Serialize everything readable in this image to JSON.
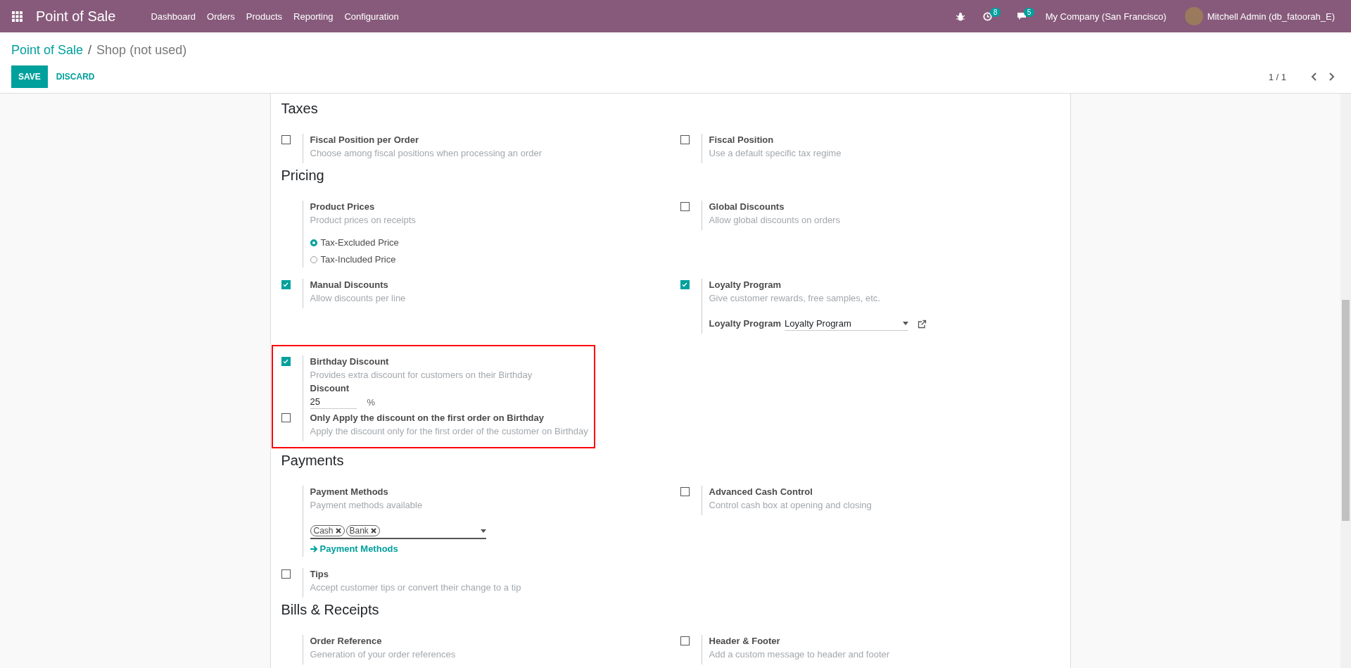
{
  "navbar": {
    "app_name": "Point of Sale",
    "menu": [
      "Dashboard",
      "Orders",
      "Products",
      "Reporting",
      "Configuration"
    ],
    "activity_count": "8",
    "message_count": "5",
    "company": "My Company (San Francisco)",
    "user": "Mitchell Admin (db_fatoorah_E)"
  },
  "breadcrumb_separator": "/",
  "breadcrumb": [
    {
      "label": "Point of Sale",
      "current": false
    },
    {
      "label": "Shop (not used)",
      "current": true
    }
  ],
  "buttons": [
    {
      "label": "SAVE",
      "kind": "primary"
    },
    {
      "label": "DISCARD",
      "kind": "secondary"
    }
  ],
  "pager": "1 / 1",
  "sections": [
    {
      "title": "Taxes",
      "settings": [
        {
          "kind": "checkbox",
          "checked": false,
          "label": "Fiscal Position per Order",
          "description": "Choose among fiscal positions when processing an order"
        },
        {
          "kind": "checkbox",
          "checked": false,
          "label": "Fiscal Position",
          "description": "Use a default specific tax regime"
        }
      ]
    },
    {
      "title": "Pricing",
      "settings": [
        {
          "kind": "plain",
          "label": "Product Prices",
          "description": "Product prices on receipts",
          "options": [
            {
              "label": "Tax-Excluded Price",
              "selected": true
            },
            {
              "label": "Tax-Included Price",
              "selected": false
            }
          ]
        },
        {
          "kind": "checkbox",
          "checked": false,
          "label": "Global Discounts",
          "description": "Allow global discounts on orders"
        },
        {
          "kind": "checkbox",
          "checked": true,
          "label": "Manual Discounts",
          "description": "Allow discounts per line"
        },
        {
          "kind": "checkbox",
          "checked": true,
          "label": "Loyalty Program",
          "description": "Give customer rewards, free samples, etc.",
          "select": {
            "label": "Loyalty Program",
            "value": "Loyalty Program"
          }
        },
        {
          "kind": "checkbox",
          "checked": true,
          "highlighted": true,
          "label": "Birthday Discount",
          "description": "Provides extra discount for customers on their Birthday",
          "input": {
            "label": "Discount",
            "value": "25",
            "unit": "%"
          },
          "sub_settings": [
            {
              "kind": "checkbox",
              "checked": false,
              "label": "Only Apply the discount on the first order on Birthday",
              "description": "Apply the discount only for the first order of the customer on Birthday"
            }
          ]
        }
      ]
    },
    {
      "title": "Payments",
      "settings": [
        {
          "kind": "plain",
          "label": "Payment Methods",
          "description": "Payment methods available",
          "tags": [
            "Cash",
            "Bank"
          ],
          "link": "Payment Methods"
        },
        {
          "kind": "checkbox",
          "checked": false,
          "label": "Advanced Cash Control",
          "description": "Control cash box at opening and closing"
        },
        {
          "kind": "checkbox",
          "checked": false,
          "label": "Tips",
          "description": "Accept customer tips or convert their change to a tip"
        }
      ]
    },
    {
      "title": "Bills & Receipts",
      "settings": [
        {
          "kind": "plain",
          "label": "Order Reference",
          "description": "Generation of your order references"
        },
        {
          "kind": "checkbox",
          "checked": false,
          "label": "Header & Footer",
          "description": "Add a custom message to header and footer"
        }
      ]
    }
  ]
}
